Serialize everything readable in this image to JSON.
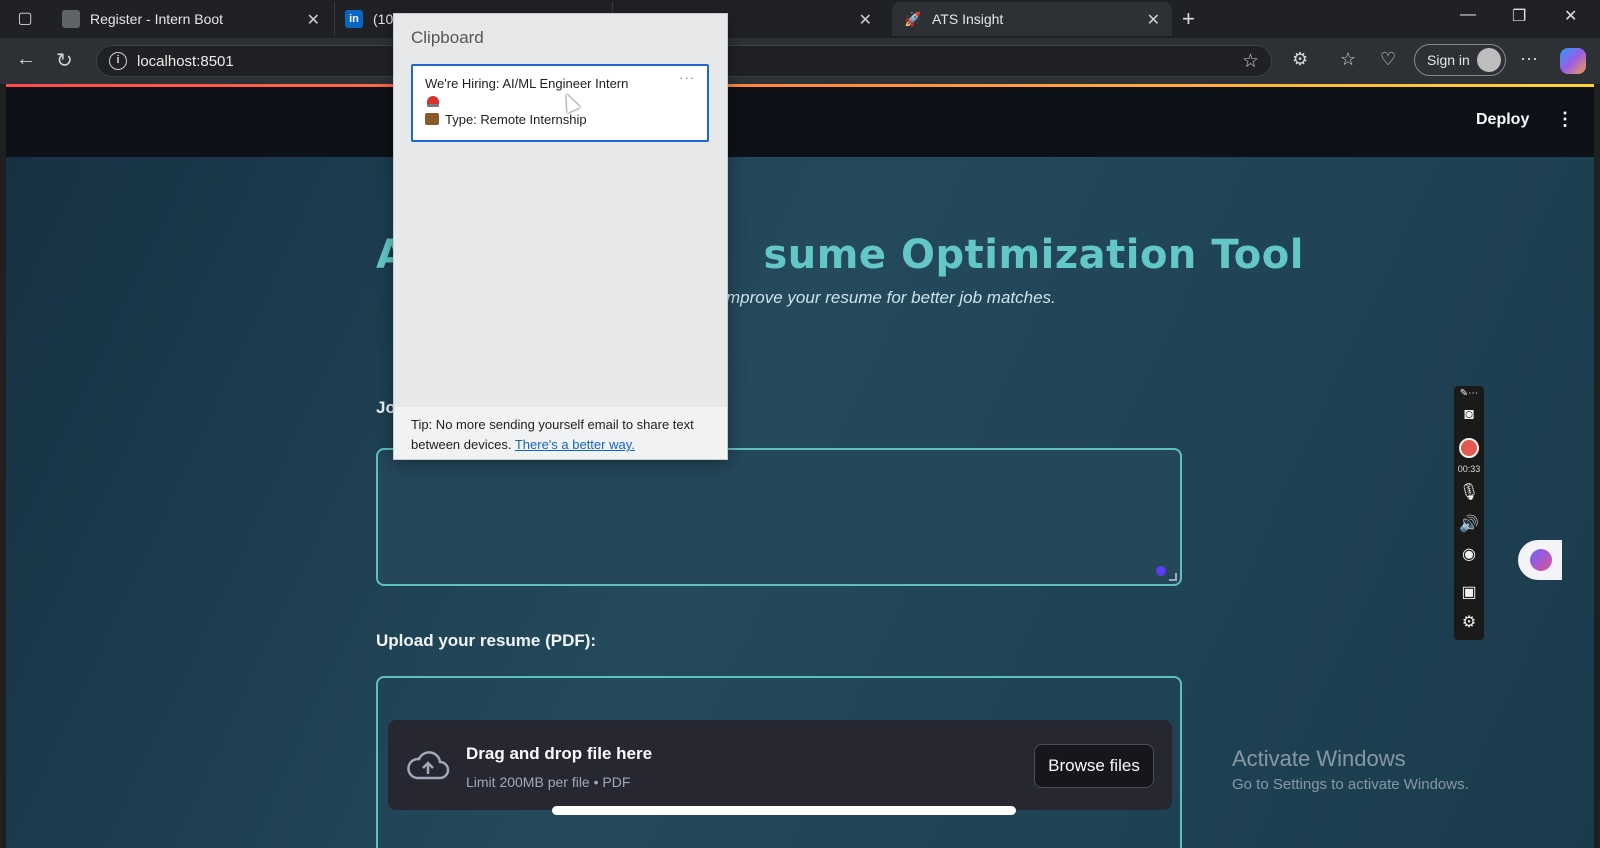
{
  "browser": {
    "tabs": [
      {
        "title": "Register - Intern Boot",
        "icon": "book-icon"
      },
      {
        "title": "(10)",
        "icon": "linkedin-icon"
      },
      {
        "title": "",
        "icon": "page-icon"
      },
      {
        "title": "ATS Insight",
        "icon": "rocket-icon",
        "active": true
      }
    ],
    "url": "localhost:8501",
    "sign_in": "Sign in"
  },
  "app": {
    "deploy": "Deploy",
    "title": "A",
    "title_tail": "sume Optimization Tool",
    "subtitle_tail": "mprove your resume for better job matches.",
    "jd_label": "Jo",
    "upload_label": "Upload your resume (PDF):",
    "dropzone": {
      "title": "Drag and drop file here",
      "limit": "Limit 200MB per file • PDF",
      "browse": "Browse files"
    },
    "accent_color": "#63c7c7"
  },
  "clipboard": {
    "header": "Clipboard",
    "item_line1": "We're Hiring: AI/ML Engineer Intern",
    "item_line3": "Type: Remote Internship",
    "tip_text": "Tip: No more sending yourself email to share text between devices.",
    "tip_link": "There's a better way."
  },
  "recorder": {
    "time": "00:33"
  },
  "watermark": {
    "line1": "Activate Windows",
    "line2": "Go to Settings to activate Windows."
  }
}
